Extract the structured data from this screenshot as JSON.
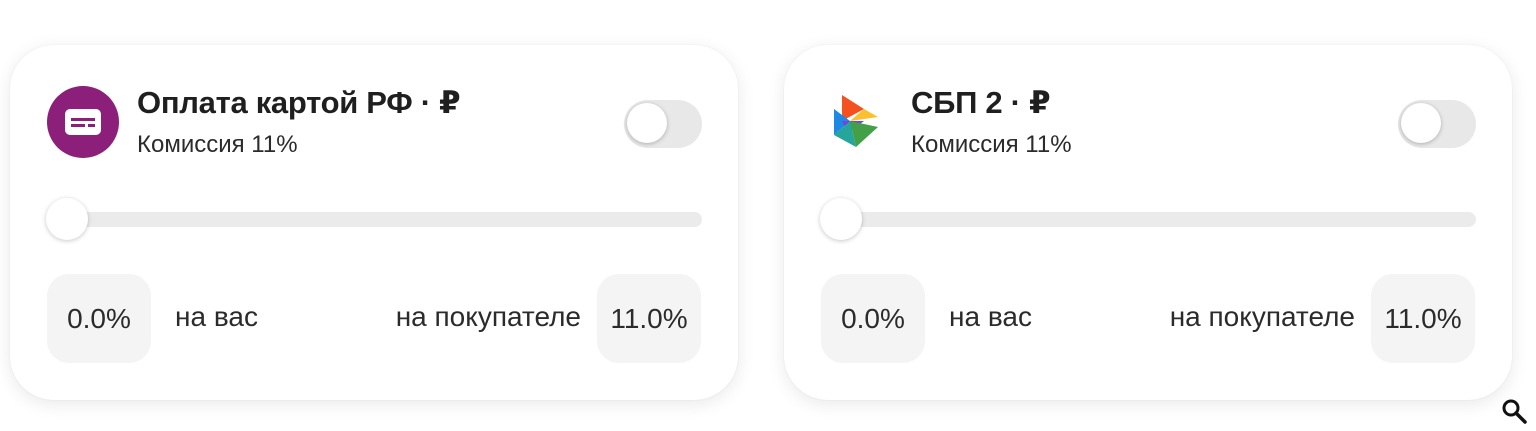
{
  "cards": [
    {
      "title": "Оплата картой РФ · ₽",
      "commission": "Комиссия 11%",
      "logo_icon": "credit-card-icon",
      "logo_color": "#8b1f7a",
      "enabled": false,
      "slider_fraction": 0.0,
      "you_pct": "0.0%",
      "you_label": "на вас",
      "buyer_label": "на покупателе",
      "buyer_pct": "11.0%"
    },
    {
      "title": "СБП 2 · ₽",
      "commission": "Комиссия 11%",
      "logo_icon": "sbp-logo-icon",
      "logo_colors": [
        "#f4511e",
        "#7b3fe4",
        "#1e88e5",
        "#43a047",
        "#fbc02d"
      ],
      "enabled": false,
      "slider_fraction": 0.0,
      "you_pct": "0.0%",
      "you_label": "на вас",
      "buyer_label": "на покупателе",
      "buyer_pct": "11.0%"
    }
  ],
  "fab": {
    "icon": "search-icon"
  }
}
